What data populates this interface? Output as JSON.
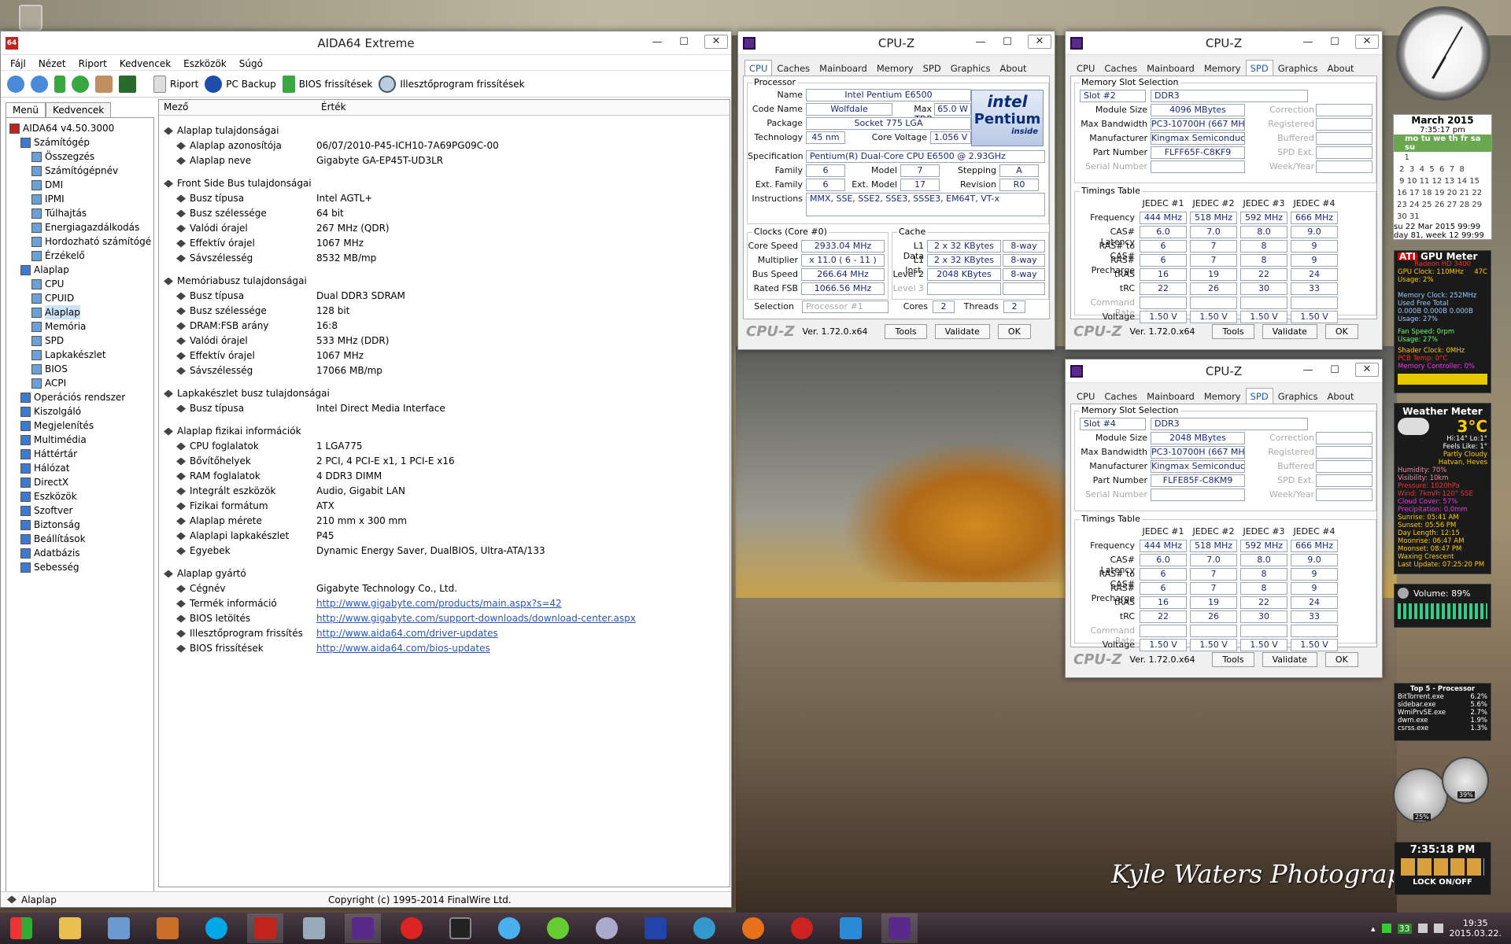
{
  "aida": {
    "title": "AIDA64 Extreme",
    "menu": [
      "Fájl",
      "Nézet",
      "Riport",
      "Kedvencek",
      "Eszközök",
      "Súgó"
    ],
    "toolbar": {
      "report": "Riport",
      "backup": "PC Backup",
      "bios": "BIOS frissítések",
      "driver": "Illesztőprogram frissítések"
    },
    "tabs": [
      "Menü",
      "Kedvencek"
    ],
    "tree": [
      {
        "label": "AIDA64 v4.50.3000",
        "lvl": 0
      },
      {
        "label": "Számítógép",
        "lvl": 1
      },
      {
        "label": "Összegzés",
        "lvl": 2
      },
      {
        "label": "Számítógépnév",
        "lvl": 2
      },
      {
        "label": "DMI",
        "lvl": 2
      },
      {
        "label": "IPMI",
        "lvl": 2
      },
      {
        "label": "Túlhajtás",
        "lvl": 2
      },
      {
        "label": "Energiagazdálkodás",
        "lvl": 2
      },
      {
        "label": "Hordozható számítógé",
        "lvl": 2
      },
      {
        "label": "Érzékelő",
        "lvl": 2
      },
      {
        "label": "Alaplap",
        "lvl": 1
      },
      {
        "label": "CPU",
        "lvl": 2
      },
      {
        "label": "CPUID",
        "lvl": 2
      },
      {
        "label": "Alaplap",
        "lvl": 2
      },
      {
        "label": "Memória",
        "lvl": 2
      },
      {
        "label": "SPD",
        "lvl": 2
      },
      {
        "label": "Lapkakészlet",
        "lvl": 2
      },
      {
        "label": "BIOS",
        "lvl": 2
      },
      {
        "label": "ACPI",
        "lvl": 2
      },
      {
        "label": "Operációs rendszer",
        "lvl": 1
      },
      {
        "label": "Kiszolgáló",
        "lvl": 1
      },
      {
        "label": "Megjelenítés",
        "lvl": 1
      },
      {
        "label": "Multimédia",
        "lvl": 1
      },
      {
        "label": "Háttértár",
        "lvl": 1
      },
      {
        "label": "Hálózat",
        "lvl": 1
      },
      {
        "label": "DirectX",
        "lvl": 1
      },
      {
        "label": "Eszközök",
        "lvl": 1
      },
      {
        "label": "Szoftver",
        "lvl": 1
      },
      {
        "label": "Biztonság",
        "lvl": 1
      },
      {
        "label": "Beállítások",
        "lvl": 1
      },
      {
        "label": "Adatbázis",
        "lvl": 1
      },
      {
        "label": "Sebesség",
        "lvl": 1
      }
    ],
    "columns": {
      "field": "Mező",
      "value": "Érték"
    },
    "groups": [
      {
        "title": "Alaplap tulajdonságai",
        "rows": [
          [
            "Alaplap azonosítója",
            "06/07/2010-P45-ICH10-7A69PG09C-00"
          ],
          [
            "Alaplap neve",
            "Gigabyte GA-EP45T-UD3LR"
          ]
        ]
      },
      {
        "title": "Front Side Bus tulajdonságai",
        "rows": [
          [
            "Busz típusa",
            "Intel AGTL+"
          ],
          [
            "Busz szélessége",
            "64 bit"
          ],
          [
            "Valódi órajel",
            "267 MHz (QDR)"
          ],
          [
            "Effektív órajel",
            "1067 MHz"
          ],
          [
            "Sávszélesség",
            "8532 MB/mp"
          ]
        ]
      },
      {
        "title": "Memóriabusz tulajdonságai",
        "rows": [
          [
            "Busz típusa",
            "Dual DDR3 SDRAM"
          ],
          [
            "Busz szélessége",
            "128 bit"
          ],
          [
            "DRAM:FSB arány",
            "16:8"
          ],
          [
            "Valódi órajel",
            "533 MHz (DDR)"
          ],
          [
            "Effektív órajel",
            "1067 MHz"
          ],
          [
            "Sávszélesség",
            "17066 MB/mp"
          ]
        ]
      },
      {
        "title": "Lapkakészlet busz tulajdonságai",
        "rows": [
          [
            "Busz típusa",
            "Intel Direct Media Interface"
          ]
        ]
      },
      {
        "title": "Alaplap fizikai információk",
        "rows": [
          [
            "CPU foglalatok",
            "1 LGA775"
          ],
          [
            "Bővítőhelyek",
            "2 PCI, 4 PCI-E x1, 1 PCI-E x16"
          ],
          [
            "RAM foglalatok",
            "4 DDR3 DIMM"
          ],
          [
            "Integrált eszközök",
            "Audio, Gigabit LAN"
          ],
          [
            "Fizikai formátum",
            "ATX"
          ],
          [
            "Alaplap mérete",
            "210 mm x 300 mm"
          ],
          [
            "Alaplapi lapkakészlet",
            "P45"
          ],
          [
            "Egyebek",
            "Dynamic Energy Saver, DualBIOS, Ultra-ATA/133"
          ]
        ]
      },
      {
        "title": "Alaplap gyártó",
        "rows": [
          [
            "Cégnév",
            "Gigabyte Technology Co., Ltd."
          ],
          [
            "Termék információ",
            "http://www.gigabyte.com/products/main.aspx?s=42"
          ],
          [
            "BIOS letöltés",
            "http://www.gigabyte.com/support-downloads/download-center.aspx"
          ],
          [
            "Illesztőprogram frissítés",
            "http://www.aida64.com/driver-updates"
          ],
          [
            "BIOS frissítések",
            "http://www.aida64.com/bios-updates"
          ]
        ]
      }
    ],
    "status_left": "Alaplap",
    "status_center": "Copyright (c) 1995-2014 FinalWire Ltd."
  },
  "cpuz_tabs": [
    "CPU",
    "Caches",
    "Mainboard",
    "Memory",
    "SPD",
    "Graphics",
    "About"
  ],
  "cpuz_common": {
    "title": "CPU-Z",
    "logo": "CPU-Z",
    "version": "Ver. 1.72.0.x64",
    "tools": "Tools",
    "validate": "Validate",
    "ok": "OK"
  },
  "cpu": {
    "processor_legend": "Processor",
    "name_lbl": "Name",
    "name": "Intel Pentium E6500",
    "code_lbl": "Code Name",
    "code": "Wolfdale",
    "tdp_lbl": "Max TDP",
    "tdp": "65.0 W",
    "pkg_lbl": "Package",
    "pkg": "Socket 775 LGA",
    "tech_lbl": "Technology",
    "tech": "45 nm",
    "volt_lbl": "Core Voltage",
    "volt": "1.056 V",
    "spec_lbl": "Specification",
    "spec": "Pentium(R) Dual-Core  CPU    E6500  @ 2.93GHz",
    "fam_lbl": "Family",
    "fam": "6",
    "model_lbl": "Model",
    "model": "7",
    "step_lbl": "Stepping",
    "step": "A",
    "efam_lbl": "Ext. Family",
    "efam": "6",
    "emodel_lbl": "Ext. Model",
    "emodel": "17",
    "rev_lbl": "Revision",
    "rev": "R0",
    "inst_lbl": "Instructions",
    "inst": "MMX, SSE, SSE2, SSE3, SSSE3, EM64T, VT-x",
    "clocks_legend": "Clocks (Core #0)",
    "cache_legend": "Cache",
    "cs_lbl": "Core Speed",
    "cs": "2933.04 MHz",
    "mul_lbl": "Multiplier",
    "mul": "x 11.0 ( 6 - 11 )",
    "bus_lbl": "Bus Speed",
    "bus": "266.64 MHz",
    "fsb_lbl": "Rated FSB",
    "fsb": "1066.56 MHz",
    "l1d_lbl": "L1 Data",
    "l1d": "2 x 32 KBytes",
    "l1d_w": "8-way",
    "l1i_lbl": "L1 Inst.",
    "l1i": "2 x 32 KBytes",
    "l1i_w": "8-way",
    "l2_lbl": "Level 2",
    "l2": "2048 KBytes",
    "l2_w": "8-way",
    "l3_lbl": "Level 3",
    "sel_lbl": "Selection",
    "sel": "Processor #1",
    "cores_lbl": "Cores",
    "cores": "2",
    "threads_lbl": "Threads",
    "threads": "2",
    "intel1": "intel",
    "intel2": "Pentium",
    "intel3": "inside"
  },
  "spd_labels": {
    "slot_legend": "Memory Slot Selection",
    "size": "Module Size",
    "bw": "Max Bandwidth",
    "mfr": "Manufacturer",
    "pn": "Part Number",
    "sn": "Serial Number",
    "corr": "Correction",
    "reg": "Registered",
    "buf": "Buffered",
    "spdext": "SPD Ext.",
    "week": "Week/Year",
    "timings": "Timings Table",
    "freq": "Frequency",
    "cas": "CAS# Latency",
    "rcd": "RAS# to CAS#",
    "rp": "RAS# Precharge",
    "tras": "tRAS",
    "trc": "tRC",
    "cr": "Command Rate",
    "volt": "Voltage"
  },
  "jedec": [
    "JEDEC #1",
    "JEDEC #2",
    "JEDEC #3",
    "JEDEC #4"
  ],
  "timing_rows": {
    "freq": [
      "444 MHz",
      "518 MHz",
      "592 MHz",
      "666 MHz"
    ],
    "cas": [
      "6.0",
      "7.0",
      "8.0",
      "9.0"
    ],
    "rcd": [
      "6",
      "7",
      "8",
      "9"
    ],
    "rp": [
      "6",
      "7",
      "8",
      "9"
    ],
    "tras": [
      "16",
      "19",
      "22",
      "24"
    ],
    "trc": [
      "22",
      "26",
      "30",
      "33"
    ],
    "volt": [
      "1.50 V",
      "1.50 V",
      "1.50 V",
      "1.50 V"
    ]
  },
  "spd1": {
    "slot": "Slot #2",
    "type": "DDR3",
    "size": "4096 MBytes",
    "bw": "PC3-10700H (667 MHz)",
    "mfr": "Kingmax Semiconductor",
    "pn": "FLFF65F-C8KF9"
  },
  "spd2": {
    "slot": "Slot #4",
    "type": "DDR3",
    "size": "2048 MBytes",
    "bw": "PC3-10700H (667 MHz)",
    "mfr": "Kingmax Semiconductor",
    "pn": "FLFE85F-C8KM9"
  },
  "gadgets": {
    "cal_month": "March 2015",
    "cal_time": "7:35:17 pm",
    "cal_days": "mo tu we th fr sa su",
    "cal_foot1": "su 22 Mar 2015   99:99",
    "cal_foot2": "day 81, week 12  99:99",
    "gpu_title": "GPU Meter",
    "gpu_name": "Radeon HD 3400",
    "gpu_clock": "GPU Clock: 110MHz",
    "gpu_temp": "47C",
    "gpu_usage": "Usage: 2%",
    "mem_clock": "Memory Clock: 252MHz",
    "mem_cols": "Used   Free   Total",
    "mem_vals": "0.000B 0.000B 0.000B",
    "mem_usage": "Usage: 27%",
    "fan": "Fan Speed: 0rpm",
    "fan_usage": "Usage: 27%",
    "shader": "Shader Clock: 0MHz",
    "pcb": "PCB Temp: 0°C",
    "memctl": "Memory Controller: 0%",
    "weather_title": "Weather Meter",
    "weather_temp": "3°C",
    "weather_hilo": "Hi:14° Lo:1°",
    "weather_feels": "Feels Like: 1°",
    "weather_cond": "Partly Cloudy",
    "weather_loc": "Hatvan, Heves",
    "weather_lines": [
      "Humidity: 70%",
      "Visibility: 10km",
      "Pressure: 1020hPa",
      "Wind: 7km/h 120° SSE",
      "Cloud Cover: 57%",
      "Precipitation: 0.0mm",
      "Sunrise: 05:41 AM",
      "Sunset: 05:56 PM",
      "Day Length: 12:15",
      "Moonrise: 06:47 AM",
      "Moonset: 08:47 PM",
      "Waxing Crescent",
      "Last Update: 07:25:20 PM"
    ],
    "volume": "Volume: 89%",
    "top5_title": "Top 5 - Processor",
    "top5": [
      [
        "BitTorrent.exe",
        "6.2%"
      ],
      [
        "sidebar.exe",
        "5.6%"
      ],
      [
        "WmiPrvSE.exe",
        "2.7%"
      ],
      [
        "dwm.exe",
        "1.9%"
      ],
      [
        "csrss.exe",
        "1.3%"
      ]
    ],
    "gauge1": "25%",
    "gauge2": "39%",
    "clock2": "7:35:18 PM",
    "lock": "LOCK ON/OFF"
  },
  "watermark": "Kyle Waters Photography ©",
  "tray": {
    "time": "19:35",
    "date": "2015.03.22.",
    "badge": "33"
  }
}
